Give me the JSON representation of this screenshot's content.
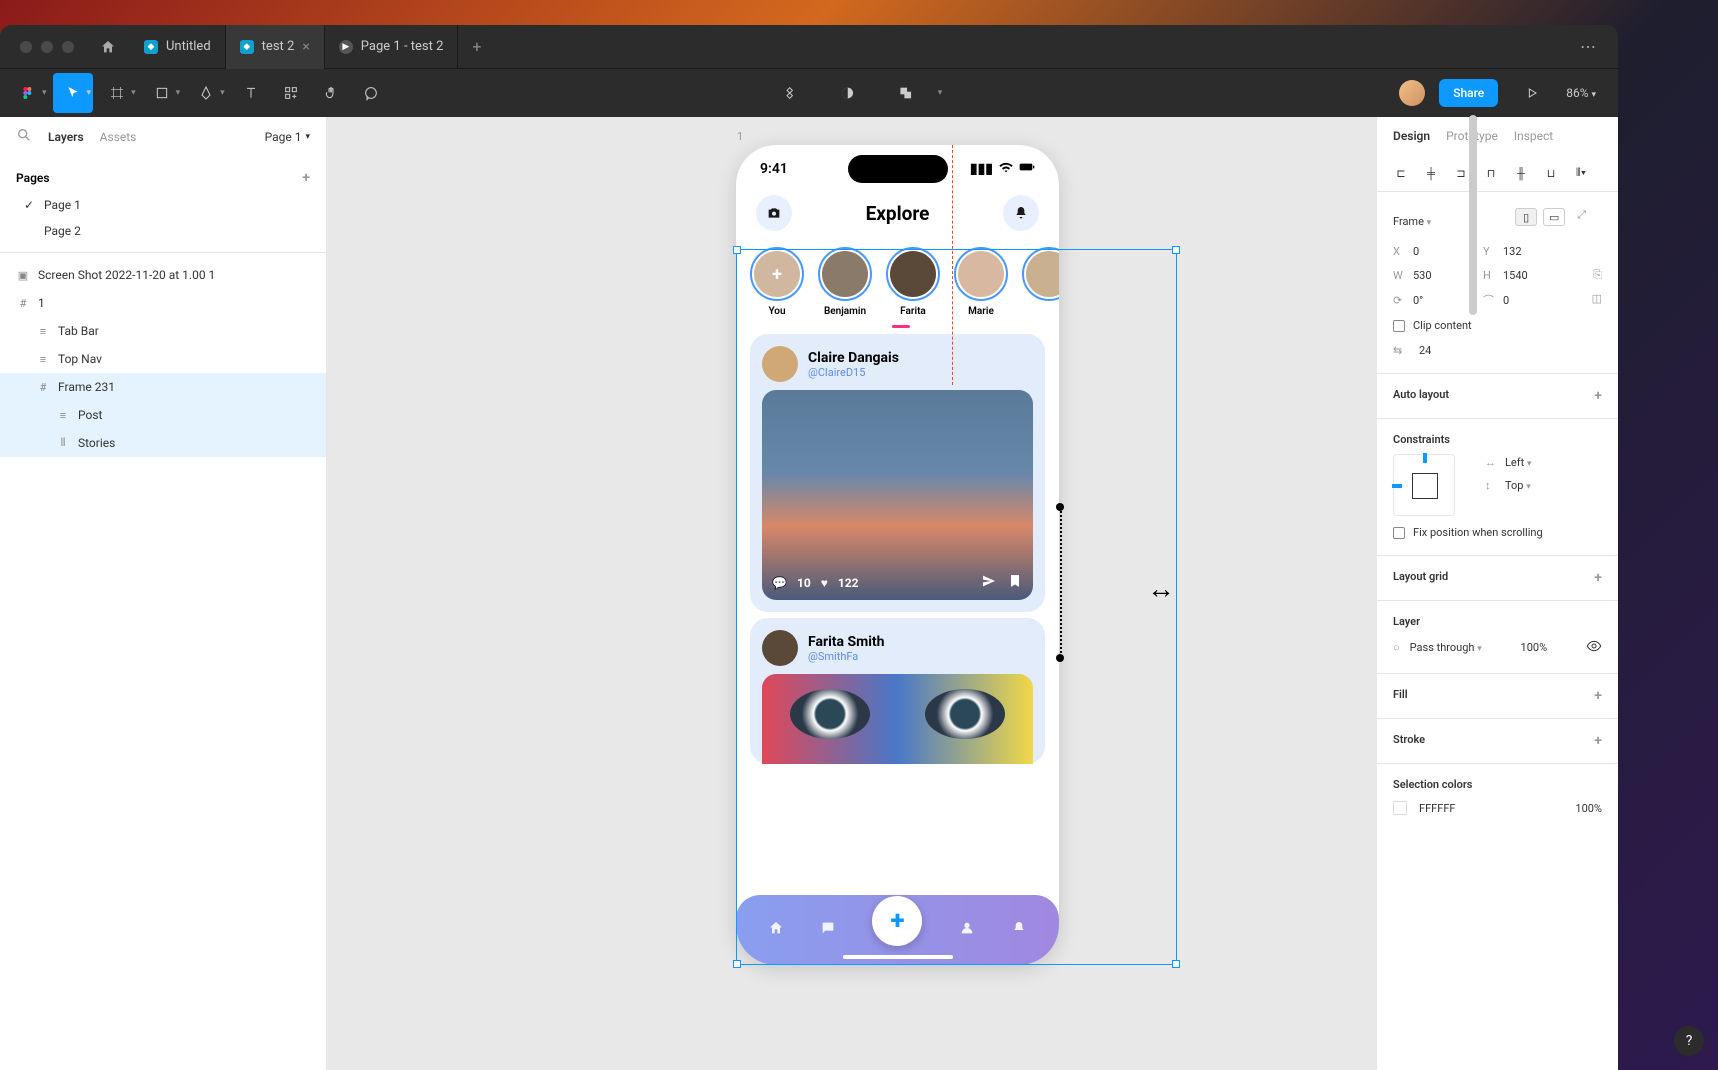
{
  "titlebar": {
    "tabs": [
      {
        "label": "Untitled",
        "active": false
      },
      {
        "label": "test 2",
        "active": true
      },
      {
        "label": "Page 1 - test 2",
        "active": false
      }
    ]
  },
  "toolbar": {
    "share_label": "Share",
    "zoom": "86%"
  },
  "left_panel": {
    "tabs": {
      "layers": "Layers",
      "assets": "Assets"
    },
    "page_select": "Page 1",
    "pages_header": "Pages",
    "pages": [
      {
        "label": "Page 1",
        "checked": true
      },
      {
        "label": "Page 2",
        "checked": false
      }
    ],
    "layers": [
      {
        "label": "Screen Shot 2022-11-20 at 1.00 1",
        "type": "image",
        "indent": 0
      },
      {
        "label": "1",
        "type": "frame",
        "indent": 0
      },
      {
        "label": "Tab Bar",
        "type": "group",
        "indent": 1
      },
      {
        "label": "Top Nav",
        "type": "group",
        "indent": 1
      },
      {
        "label": "Frame 231",
        "type": "frame",
        "indent": 1,
        "selected": true
      },
      {
        "label": "Post",
        "type": "group",
        "indent": 2
      },
      {
        "label": "Stories",
        "type": "stack",
        "indent": 2
      }
    ]
  },
  "canvas": {
    "frame_label": "1",
    "phone": {
      "time": "9:41",
      "header_title": "Explore",
      "stories": [
        {
          "name": "You",
          "you": true
        },
        {
          "name": "Benjamin"
        },
        {
          "name": "Farita"
        },
        {
          "name": "Marie"
        }
      ],
      "post1": {
        "name": "Claire Dangais",
        "handle": "@ClaireD15",
        "comments": "10",
        "likes": "122"
      },
      "post2": {
        "name": "Farita Smith",
        "handle": "@SmithFa"
      }
    }
  },
  "right_panel": {
    "tabs": {
      "design": "Design",
      "prototype": "Prototype",
      "inspect": "Inspect"
    },
    "frame_label": "Frame",
    "x": "0",
    "y": "132",
    "w": "530",
    "h": "1540",
    "rotation": "0°",
    "radius": "0",
    "clip_content": "Clip content",
    "spacing": "24",
    "auto_layout": "Auto layout",
    "constraints": "Constraints",
    "constraint_h": "Left",
    "constraint_v": "Top",
    "fix_position": "Fix position when scrolling",
    "layout_grid": "Layout grid",
    "layer": "Layer",
    "blend_mode": "Pass through",
    "opacity": "100%",
    "fill": "Fill",
    "stroke": "Stroke",
    "selection_colors": "Selection colors",
    "color1": "FFFFFF",
    "color1_pct": "100%"
  }
}
